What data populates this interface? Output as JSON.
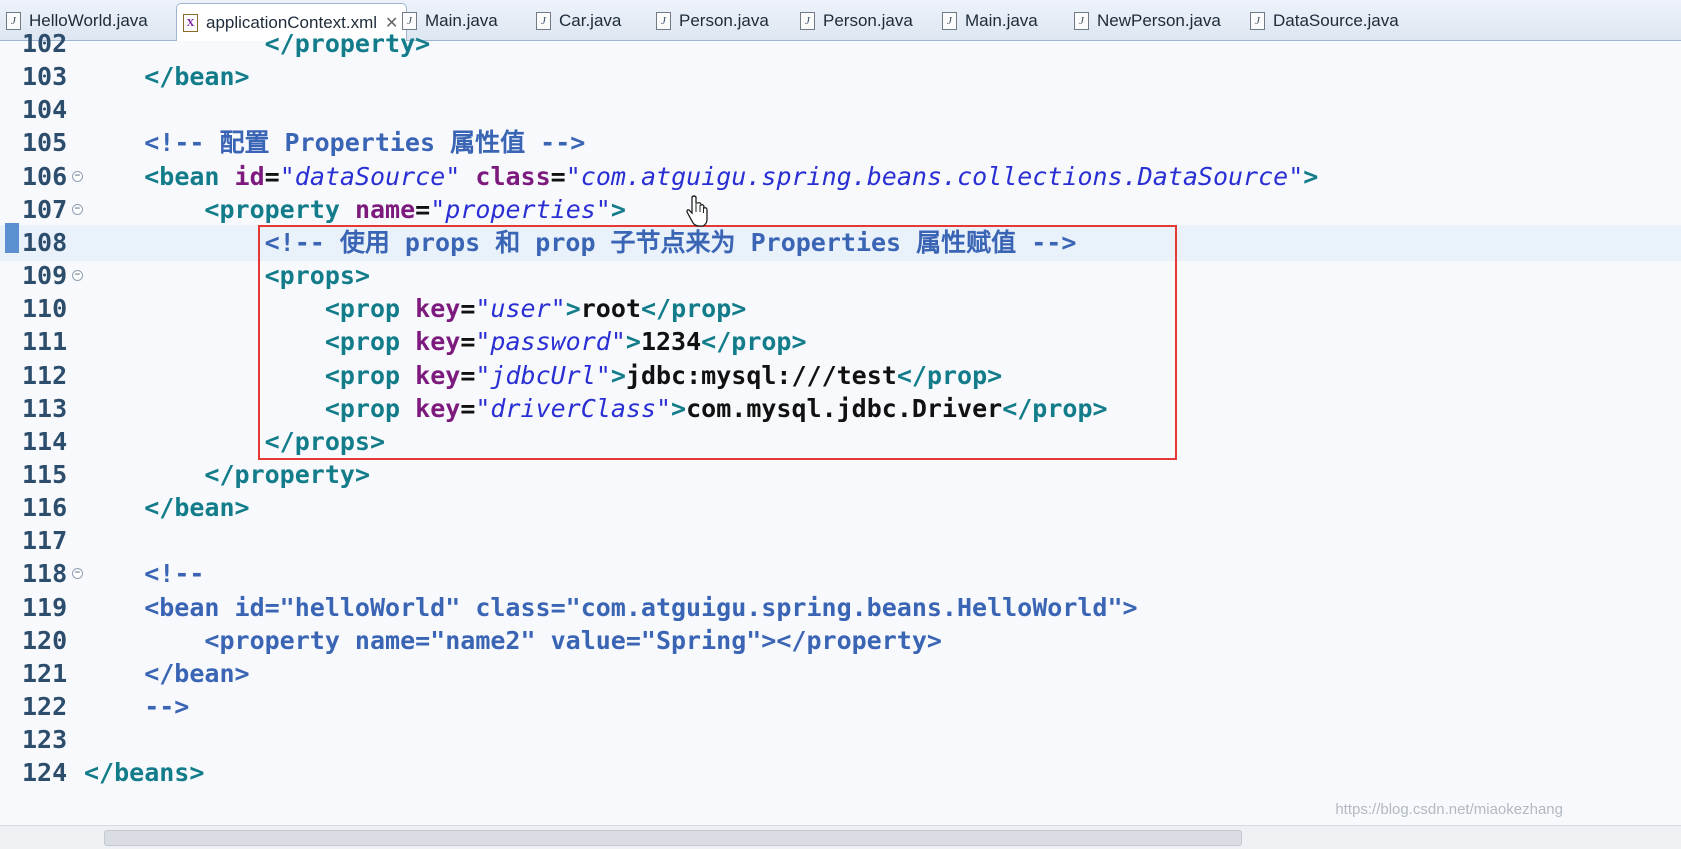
{
  "tabs": [
    {
      "label": "HelloWorld.java",
      "icon": "java-file-icon"
    },
    {
      "label": "applicationContext.xml",
      "icon": "xml-file-icon",
      "active": true,
      "close": "✕"
    },
    {
      "label": "Main.java",
      "icon": "java-file-icon"
    },
    {
      "label": "Car.java",
      "icon": "java-file-icon"
    },
    {
      "label": "Person.java",
      "icon": "java-file-icon"
    },
    {
      "label": "Person.java",
      "icon": "java-file-icon"
    },
    {
      "label": "Main.java",
      "icon": "java-file-icon"
    },
    {
      "label": "NewPerson.java",
      "icon": "java-file-icon"
    },
    {
      "label": "DataSource.java",
      "icon": "java-file-icon"
    }
  ],
  "editor": {
    "current_line": "108",
    "lines": [
      {
        "n": "102",
        "t": "            </property>"
      },
      {
        "n": "103",
        "t": "    </bean>"
      },
      {
        "n": "104",
        "t": ""
      },
      {
        "n": "105",
        "t": "    <!-- 配置 Properties 属性值 -->"
      },
      {
        "n": "106",
        "t": "    <bean id=\"dataSource\" class=\"com.atguigu.spring.beans.collections.DataSource\">",
        "fold": true
      },
      {
        "n": "107",
        "t": "        <property name=\"properties\">",
        "fold": true
      },
      {
        "n": "108",
        "t": "            <!-- 使用 props 和 prop 子节点来为 Properties 属性赋值 -->"
      },
      {
        "n": "109",
        "t": "            <props>",
        "fold": true
      },
      {
        "n": "110",
        "t": "                <prop key=\"user\">root</prop>"
      },
      {
        "n": "111",
        "t": "                <prop key=\"password\">1234</prop>"
      },
      {
        "n": "112",
        "t": "                <prop key=\"jdbcUrl\">jdbc:mysql:///test</prop>"
      },
      {
        "n": "113",
        "t": "                <prop key=\"driverClass\">com.mysql.jdbc.Driver</prop>"
      },
      {
        "n": "114",
        "t": "            </props>"
      },
      {
        "n": "115",
        "t": "        </property>"
      },
      {
        "n": "116",
        "t": "    </bean>"
      },
      {
        "n": "117",
        "t": ""
      },
      {
        "n": "118",
        "t": "    <!--",
        "fold": true
      },
      {
        "n": "119",
        "t": "    <bean id=\"helloWorld\" class=\"com.atguigu.spring.beans.HelloWorld\">"
      },
      {
        "n": "120",
        "t": "        <property name=\"name2\" value=\"Spring\"></property>"
      },
      {
        "n": "121",
        "t": "    </bean>"
      },
      {
        "n": "122",
        "t": "    -->"
      },
      {
        "n": "123",
        "t": ""
      },
      {
        "n": "124",
        "t": "</beans>"
      }
    ]
  },
  "watermark": "https://blog.csdn.net/miaokezhang",
  "colors": {
    "tag": "#137c8a",
    "attribute": "#7d1a7d",
    "value": "#2a2fd4",
    "comment": "#3a64b4",
    "highlight_box": "#e53935"
  }
}
